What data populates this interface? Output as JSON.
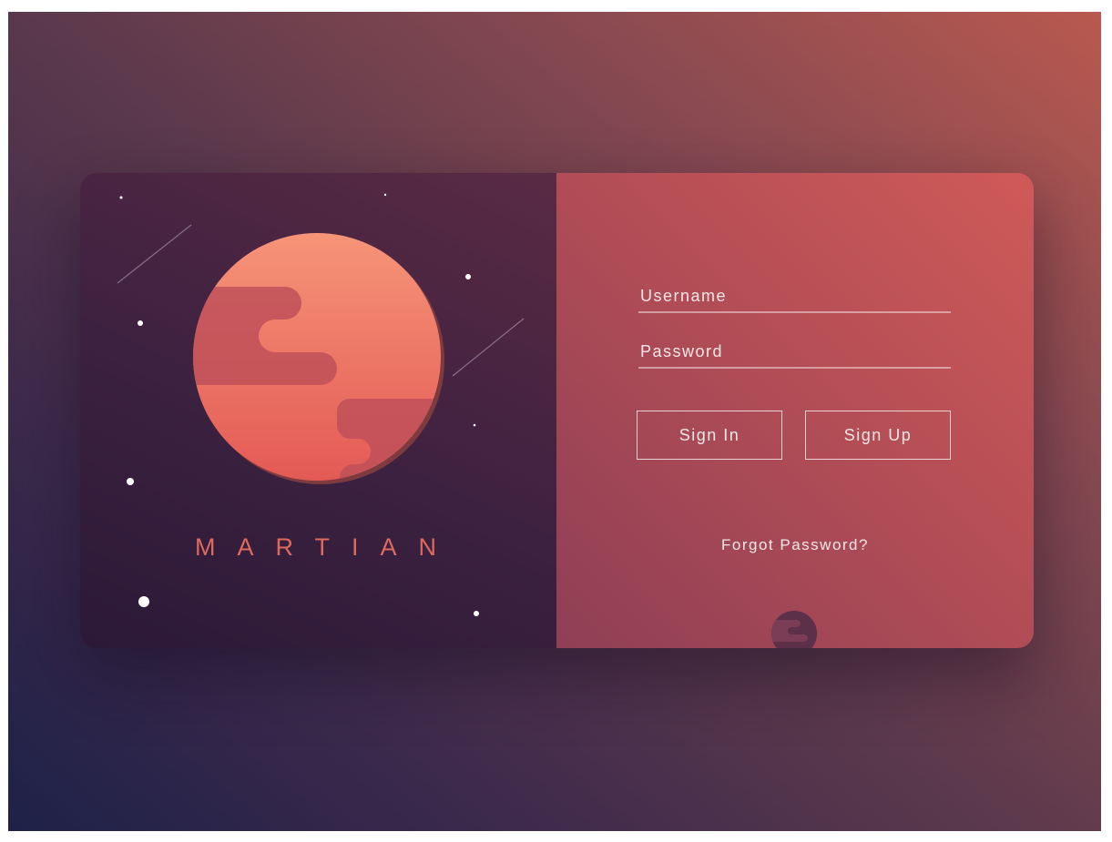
{
  "brand": {
    "name": "MARTIAN"
  },
  "form": {
    "username_placeholder": "Username",
    "password_placeholder": "Password",
    "signin_label": "Sign In",
    "signup_label": "Sign Up",
    "forgot_label": "Forgot Password?"
  },
  "icons": {
    "planet": "mars-planet-icon",
    "mini_planet": "small-planet-icon",
    "stars": "star-dots",
    "meteors": "shooting-star-lines"
  },
  "colors": {
    "background_start": "#1e2148",
    "background_end": "#b9594f",
    "left_panel": "#3c2140",
    "right_panel": "#b44e56",
    "planet_light": "#f69478",
    "planet_dark": "#e35a55",
    "brand_text": "#dd6a5d"
  }
}
